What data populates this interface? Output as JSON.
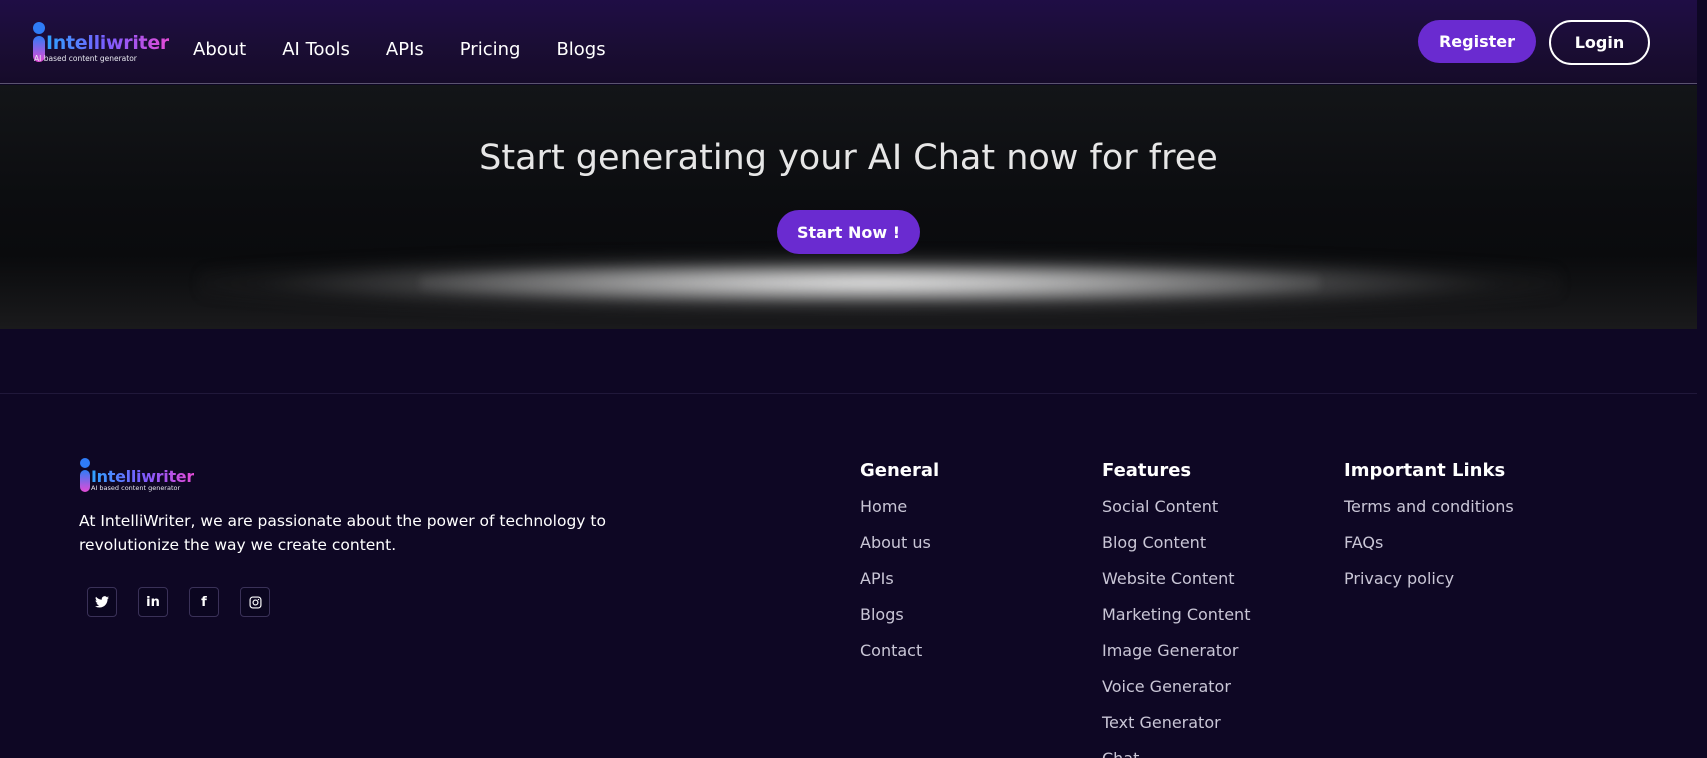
{
  "header": {
    "logo_name": "Intelliwriter",
    "logo_tagline": "AI based content generator",
    "nav": [
      "About",
      "AI Tools",
      "APIs",
      "Pricing",
      "Blogs"
    ],
    "register_label": "Register",
    "login_label": "Login"
  },
  "cta": {
    "title": "Start generating your AI Chat now for free",
    "button_label": "Start Now !"
  },
  "footer": {
    "logo_name": "Intelliwriter",
    "logo_tagline": "AI based content generator",
    "about": "At IntelliWriter, we are passionate about the power of technology to revolutionize the way we create content.",
    "socials": [
      {
        "icon": "twitter-icon",
        "glyph": "🐦"
      },
      {
        "icon": "linkedin-icon",
        "glyph": "in"
      },
      {
        "icon": "facebook-icon",
        "glyph": "f"
      },
      {
        "icon": "instagram-icon",
        "glyph": "◎"
      }
    ],
    "columns": [
      {
        "title": "General",
        "links": [
          "Home",
          "About us",
          "APIs",
          "Blogs",
          "Contact"
        ]
      },
      {
        "title": "Features",
        "links": [
          "Social Content",
          "Blog Content",
          "Website Content",
          "Marketing Content",
          "Image Generator",
          "Voice Generator",
          "Text Generator",
          "Chat"
        ]
      },
      {
        "title": "Important Links",
        "links": [
          "Terms and conditions",
          "FAQs",
          "Privacy policy"
        ]
      }
    ]
  },
  "colors": {
    "accent": "#6a2bd0",
    "footer_bg": "#0e0724",
    "header_bg": "#1f0d45"
  }
}
